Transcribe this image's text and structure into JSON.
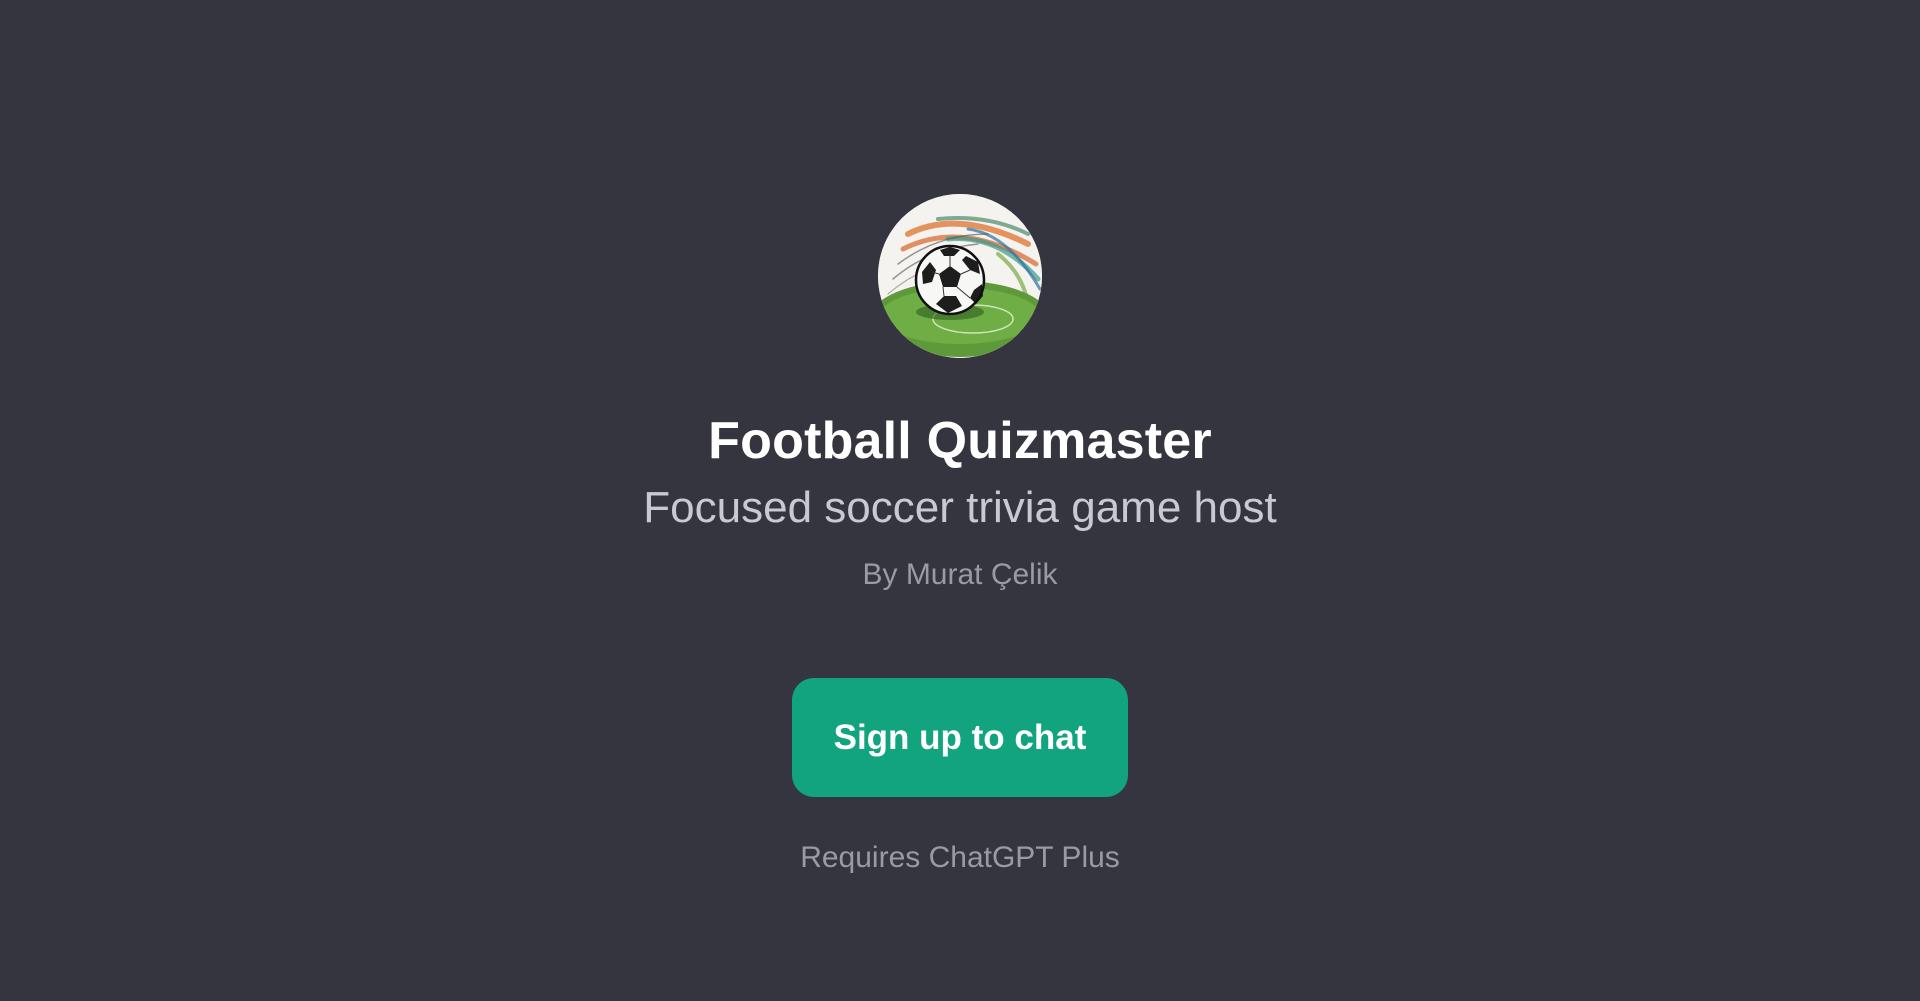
{
  "gpt": {
    "avatar_icon": "soccer-ball-icon",
    "name": "Football Quizmaster",
    "description": "Focused soccer trivia game host",
    "author": "By Murat Çelik"
  },
  "cta": {
    "label": "Sign up to chat",
    "note": "Requires ChatGPT Plus"
  },
  "colors": {
    "background": "#353540",
    "accent": "#12a37f",
    "title": "#ffffff",
    "subtitle": "#c9c9d1",
    "muted": "#9a9aa3"
  }
}
